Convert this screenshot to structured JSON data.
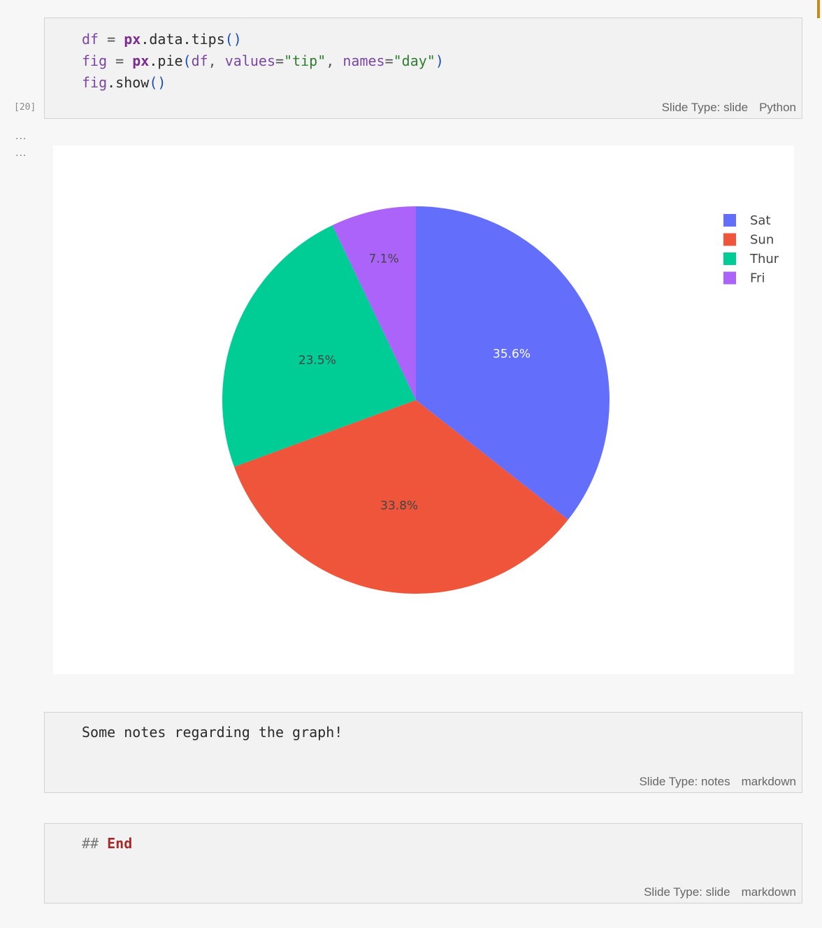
{
  "code_cell": {
    "execution_count": "[20]",
    "line1": {
      "var": "df",
      "op": "=",
      "mod": "px",
      "rest": ".data.tips",
      "open": "(",
      "close": ")"
    },
    "line2": {
      "var": "fig",
      "op": "=",
      "mod": "px",
      "rest": ".pie",
      "open": "(",
      "arg1": "df",
      "comma1": ", ",
      "kw1": "values",
      "eq1": "=",
      "str1": "\"tip\"",
      "comma2": ", ",
      "kw2": "names",
      "eq2": "=",
      "str2": "\"day\"",
      "close": ")"
    },
    "line3": {
      "var": "fig",
      "rest": ".show",
      "open": "(",
      "close": ")"
    },
    "slide_type": "Slide Type: slide",
    "language": "Python"
  },
  "collapsers": [
    "...",
    "..."
  ],
  "colors": {
    "accent_marker": "#c98a18",
    "cell_background": "#f2f2f2"
  },
  "chart_data": {
    "type": "pie",
    "categories": [
      "Sat",
      "Sun",
      "Thur",
      "Fri"
    ],
    "values": [
      35.6,
      33.8,
      23.5,
      7.1
    ],
    "labels": [
      "35.6%",
      "33.8%",
      "23.5%",
      "7.1%"
    ],
    "colors": [
      "#636efa",
      "#ef553b",
      "#00cc96",
      "#ab63fa"
    ],
    "label_colors": [
      "#ffffff",
      "#444444",
      "#444444",
      "#444444"
    ],
    "direction": "clockwise",
    "start_angle": "top",
    "legend": {
      "position": "top-right",
      "entries": [
        "Sat",
        "Sun",
        "Thur",
        "Fri"
      ]
    }
  },
  "notes_cell": {
    "text": "Some notes regarding the graph!",
    "slide_type": "Slide Type: notes",
    "language": "markdown"
  },
  "end_cell": {
    "hash": "##",
    "heading": "End",
    "slide_type": "Slide Type: slide",
    "language": "markdown"
  }
}
